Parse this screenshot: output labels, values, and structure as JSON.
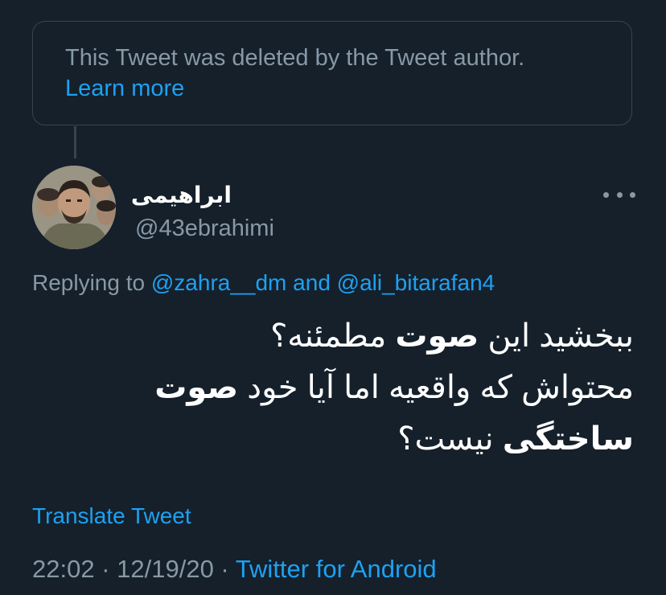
{
  "deleted_notice": {
    "text": "This Tweet was deleted by the Tweet author.",
    "link": "Learn more"
  },
  "author": {
    "display_name": "ابراهیمی",
    "handle": "@43ebrahimi"
  },
  "more_icon": "more-horizontal-icon",
  "replying": {
    "prefix": "Replying to ",
    "mention_1": "@zahra__dm",
    "conjunction": " and ",
    "mention_2": "@ali_bitarafan4"
  },
  "tweet": {
    "line1_a": "ببخشید این ",
    "line1_bold": "صوت",
    "line1_b": " مطمئنه؟",
    "line2_a": "محتواش که واقعیه اما آیا خود ",
    "line2_bold": "صوت",
    "line3_bold": "ساختگی",
    "line3_b": " نیست؟"
  },
  "translate_link": "Translate Tweet",
  "meta": {
    "time": "22:02",
    "separator": " · ",
    "date": "12/19/20",
    "source": "Twitter for Android"
  },
  "colors": {
    "background": "#15202b",
    "border": "#38444d",
    "secondary_text": "#8899a6",
    "link": "#1da1f2",
    "primary_text": "#ffffff"
  }
}
